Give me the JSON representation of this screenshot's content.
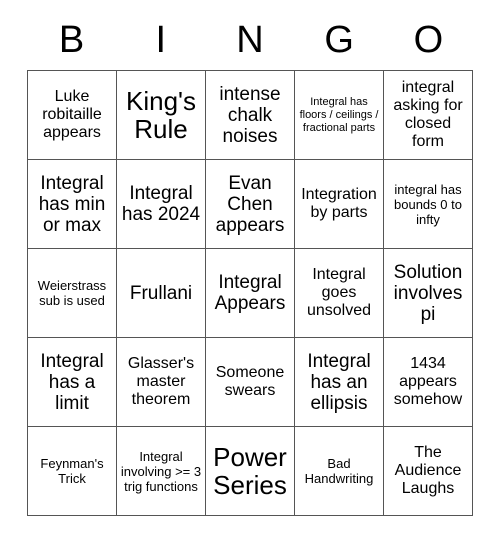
{
  "card": {
    "header_letters": [
      "B",
      "I",
      "N",
      "G",
      "O"
    ],
    "rows": [
      [
        {
          "text": "Luke robitaille appears",
          "size": "fs-md"
        },
        {
          "text": "King's Rule",
          "size": "fs-xl"
        },
        {
          "text": "intense chalk noises",
          "size": "fs-lg"
        },
        {
          "text": "Integral has floors / ceilings / fractional parts",
          "size": "fs-xs"
        },
        {
          "text": "integral asking for closed form",
          "size": "fs-md"
        }
      ],
      [
        {
          "text": "Integral has min or max",
          "size": "fs-lg"
        },
        {
          "text": "Integral has 2024",
          "size": "fs-lg"
        },
        {
          "text": "Evan Chen appears",
          "size": "fs-lg"
        },
        {
          "text": "Integration by parts",
          "size": "fs-md"
        },
        {
          "text": "integral has bounds 0 to infty",
          "size": "fs-sm"
        }
      ],
      [
        {
          "text": "Weierstrass sub is used",
          "size": "fs-sm"
        },
        {
          "text": "Frullani",
          "size": "fs-lg"
        },
        {
          "text": "Integral Appears",
          "size": "fs-lg"
        },
        {
          "text": "Integral goes unsolved",
          "size": "fs-md"
        },
        {
          "text": "Solution involves pi",
          "size": "fs-lg"
        }
      ],
      [
        {
          "text": "Integral has a limit",
          "size": "fs-lg"
        },
        {
          "text": "Glasser's master theorem",
          "size": "fs-md"
        },
        {
          "text": "Someone swears",
          "size": "fs-md"
        },
        {
          "text": "Integral has an ellipsis",
          "size": "fs-lg"
        },
        {
          "text": "1434 appears somehow",
          "size": "fs-md"
        }
      ],
      [
        {
          "text": "Feynman's Trick",
          "size": "fs-sm"
        },
        {
          "text": "Integral involving >= 3 trig functions",
          "size": "fs-sm"
        },
        {
          "text": "Power Series",
          "size": "fs-xl"
        },
        {
          "text": "Bad Handwriting",
          "size": "fs-sm"
        },
        {
          "text": "The Audience Laughs",
          "size": "fs-md"
        }
      ]
    ]
  },
  "colors": {
    "background": "#ffffff",
    "border": "#555555",
    "text": "#000000"
  }
}
